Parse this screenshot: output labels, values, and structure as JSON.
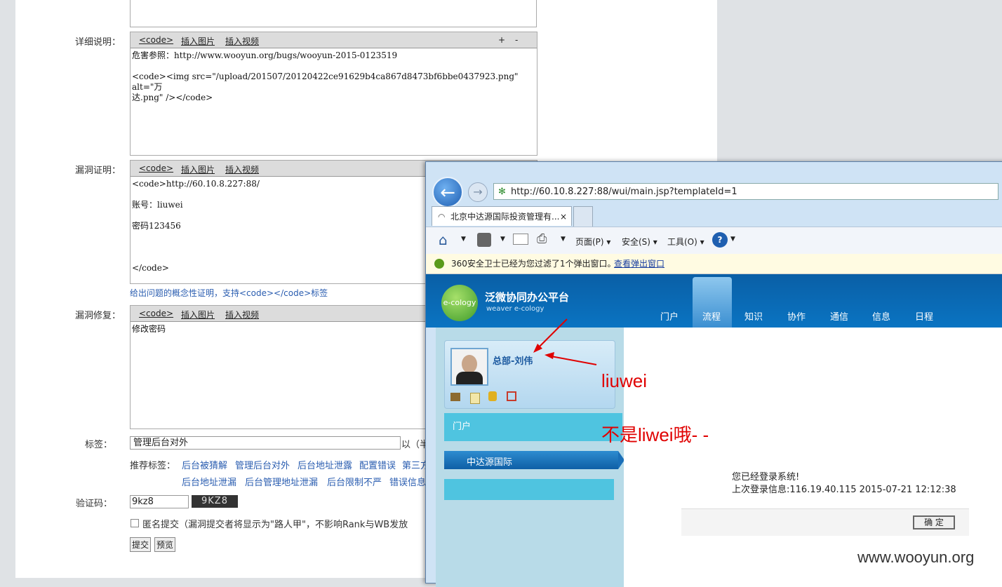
{
  "form": {
    "detail_label": "详细说明：",
    "proof_label": "漏洞证明：",
    "fix_label": "漏洞修复：",
    "tags_label": "标签：",
    "recommend_label": "推荐标签：",
    "captcha_label": "验证码：",
    "toolbar": {
      "code": "<code>",
      "insert_image": "插入图片",
      "insert_video": "插入视频",
      "plus": "+",
      "minus": "-"
    },
    "detail_text": "危害参照：http://www.wooyun.org/bugs/wooyun-2015-0123519\n\n<code><img src=\"/upload/201507/20120422ce91629b4ca867d8473bf6bbe0437923.png\" alt=\"万\n达.png\" /></code>",
    "proof_text": "<code>http://60.10.8.227:88/\n\n账号：liuwei\n\n密码123456\n\n\n\n</code>",
    "proof_hint": "给出问题的概念性证明，支持<code></code>标签",
    "fix_text": "修改密码",
    "tags_value": "管理后台对外",
    "tags_suffix": "以（半",
    "recommended_tags_row1": [
      "后台被猜解",
      "管理后台对外",
      "后台地址泄露",
      "配置错误",
      "第三方"
    ],
    "recommended_tags_row2": [
      "后台地址泄漏",
      "后台管理地址泄漏",
      "后台限制不严",
      "错误信息"
    ],
    "captcha_value": "9kz8",
    "captcha_image_text": "9KZ8",
    "anonymous_label": "匿名提交（漏洞提交者将显示为\"路人甲\"，不影响Rank与WB发放",
    "submit_label": "提交",
    "preview_label": "预览"
  },
  "browser": {
    "url": "http://60.10.8.227:88/wui/main.jsp?templateId=1",
    "tab_title": "北京中达源国际投资管理有...",
    "tab_close": "×",
    "cmd_page": "页面(P)",
    "cmd_security": "安全(S)",
    "cmd_tools": "工具(O)",
    "infobar_text": "360安全卫士已经为您过滤了1个弹出窗口。",
    "infobar_link": "查看弹出窗口"
  },
  "app": {
    "logo_text": "e-cology",
    "title": "泛微协同办公平台",
    "subtitle": "weaver e-cology",
    "nav": [
      "门户",
      "流程",
      "知识",
      "协作",
      "通信",
      "信息",
      "日程"
    ],
    "user_name": "总部-刘伟",
    "menu_portal": "门户",
    "menu_org": "中达源国际",
    "login_msg": "您已经登录系统!",
    "last_login": "上次登录信息:116.19.40.115 2015-07-21 12:12:38",
    "ok_button": "确 定"
  },
  "annotations": {
    "name": "liuwei",
    "note": "不是liwei哦- -"
  },
  "watermark": "www.wooyun.org"
}
